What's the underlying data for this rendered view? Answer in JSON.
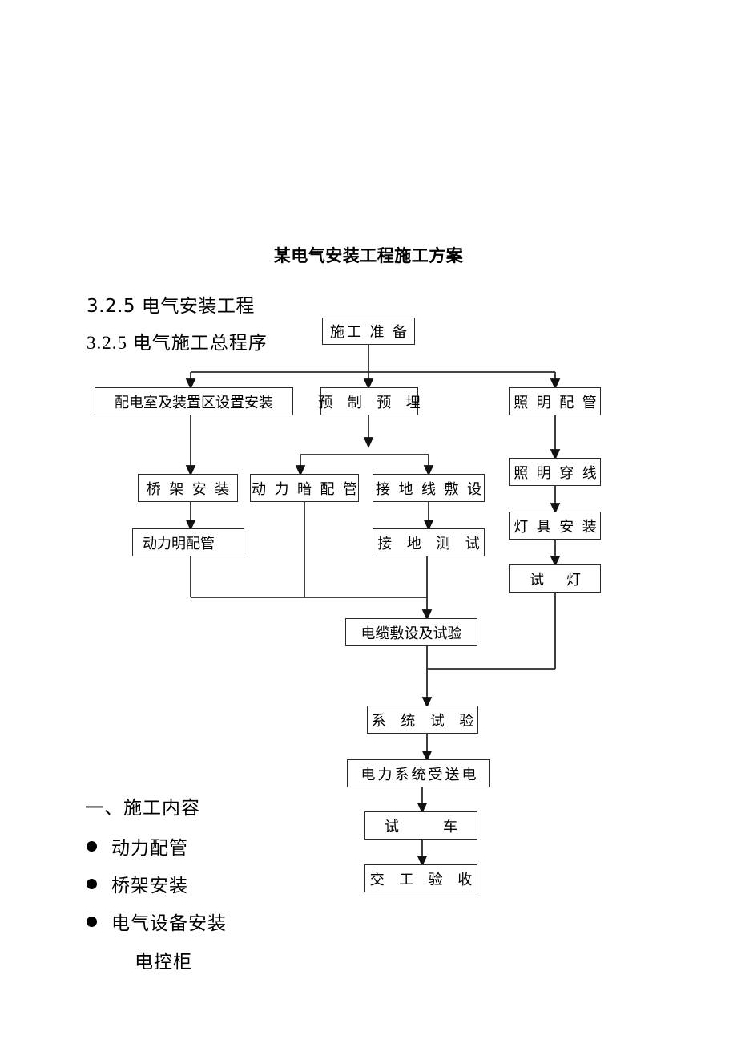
{
  "document": {
    "title": "某电气安装工程施工方案",
    "heading_1": "3.2.5 电气安装工程",
    "heading_2": "3.2.5  电气施工总程序"
  },
  "flowchart": {
    "nodes": {
      "prep": "施工 准 备",
      "switchroom": "配电室及装置区设置安装",
      "prefab": "预 制 预 埋",
      "lighting_conduit": "照 明 配 管",
      "tray_install": "桥 架 安 装",
      "power_concealed": "动 力 暗 配 管",
      "ground_wire": "接 地 线 敷 设",
      "lighting_wiring": "照 明 穿 线",
      "power_exposed": "动力明配管",
      "ground_test": "接 地 测 试",
      "lamp_install": "灯 具 安 装",
      "lamp_test_left": "试",
      "lamp_test_right": "灯",
      "cable_lay_test": "电缆敷设及试验",
      "system_test": "系 统 试 验",
      "power_supply": "电力系统受送电",
      "trial_run_left": "试",
      "trial_run_right": "车",
      "handover": "交 工 验 收"
    }
  },
  "content_section": {
    "section_title": "一、施工内容",
    "bullets": [
      "动力配管",
      "桥架安装",
      "电气设备安装"
    ],
    "sub_item": "电控柜"
  },
  "colors": {
    "ink": "#000000",
    "line": "#2a2a2a",
    "page": "#ffffff"
  }
}
